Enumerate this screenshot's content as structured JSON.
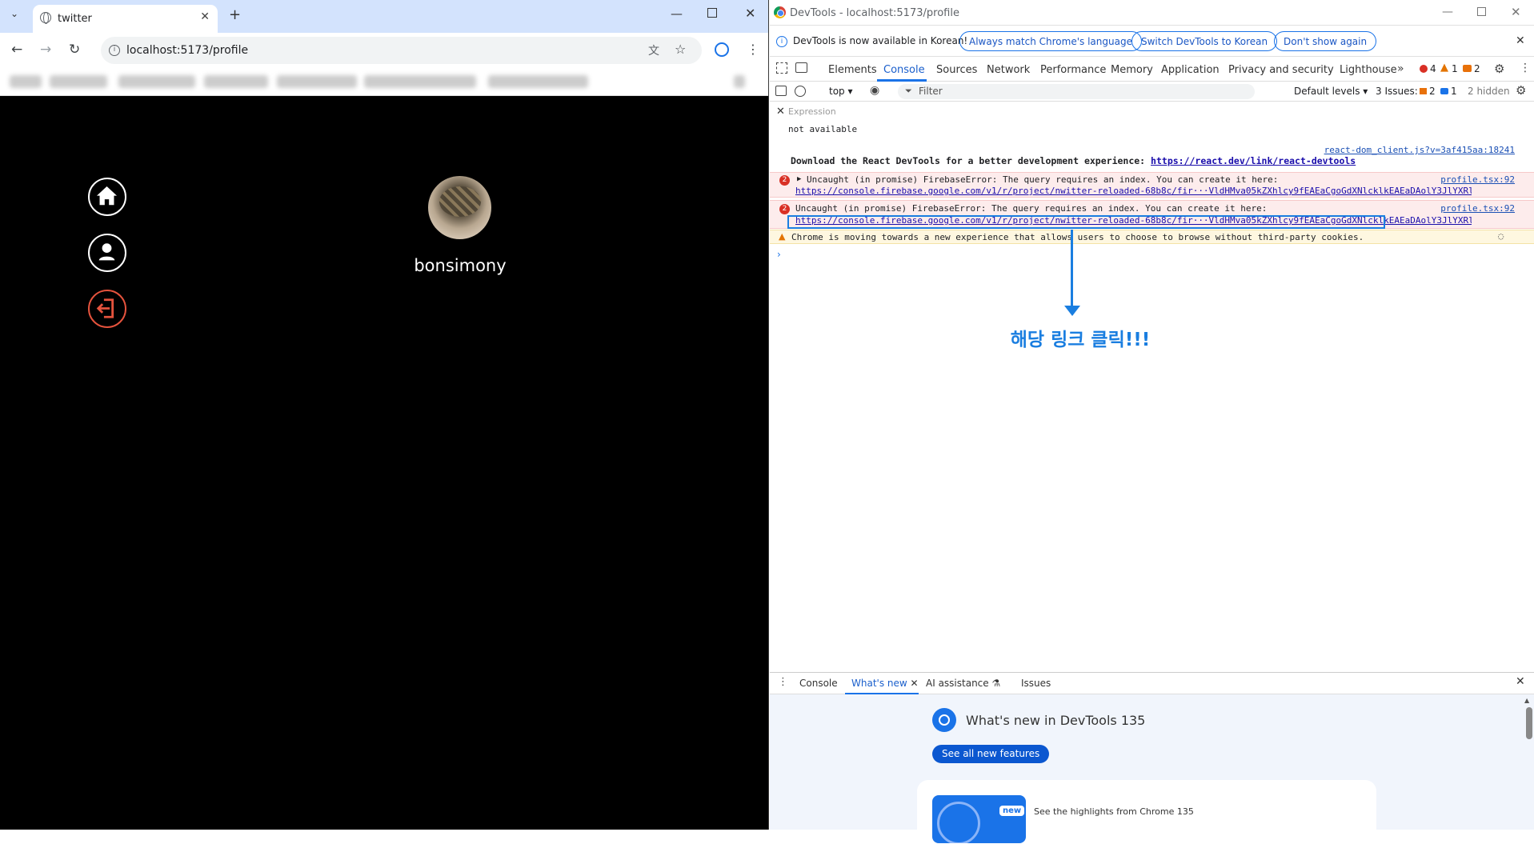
{
  "browser": {
    "tab_title": "twitter",
    "url": "localhost:5173/profile",
    "profile_name": "bonsimony"
  },
  "devtools": {
    "window_title": "DevTools - localhost:5173/profile",
    "infobar": {
      "message": "DevTools is now available in Korean!",
      "btn_match": "Always match Chrome's language",
      "btn_switch": "Switch DevTools to Korean",
      "btn_dismiss": "Don't show again"
    },
    "tabs": [
      "Elements",
      "Console",
      "Sources",
      "Network",
      "Performance",
      "Memory",
      "Application",
      "Privacy and security",
      "Lighthouse"
    ],
    "counts": {
      "errors": "4",
      "warnings": "1",
      "issues": "2"
    },
    "console_toolbar": {
      "context": "top",
      "filter_placeholder": "Filter",
      "levels": "Default levels",
      "issues_label": "3 Issues:",
      "issues_err": "2",
      "issues_info": "1",
      "hidden": "2 hidden"
    },
    "expression": {
      "label": "Expression",
      "value": "not available"
    },
    "messages": {
      "react_src": "react-dom_client.js?v=3af415aa:18241",
      "react_text": "Download the React DevTools for a better development experience: ",
      "react_link": "https://react.dev/link/react-devtools",
      "err1_text": "Uncaught (in promise) FirebaseError: The query requires an index. You can create it here:",
      "err1_link": "https://console.firebase.google.com/v1/r/project/nwitter-reloaded-68b8c/fir···VldHMva05kZXhlcy9fEAEaCgoGdXNlcklkEAEaDAolY3JlYXRlQXQQAhoMCghfX25hbWVf",
      "err1_src": "profile.tsx:92",
      "err1_count": "2",
      "err2_text": "Uncaught (in promise) FirebaseError: The query requires an index. You can create it here:",
      "err2_link": "https://console.firebase.google.com/v1/r/project/nwitter-reloaded-68b8c/fir···VldHMva05kZXhlcy9fEAEaCgoGdXNlcklkEAEaDAolY3JlYXRlQXQQAhoMCghfX25hbWVf",
      "err2_src": "profile.tsx:92",
      "err2_count": "2",
      "warn_text": "Chrome is moving towards a new experience that allows users to choose to browse without third-party cookies."
    },
    "annotation": "해당 링크 클릭!!!",
    "drawer": {
      "tabs": [
        "Console",
        "What's new",
        "AI assistance",
        "Issues"
      ],
      "heading": "What's new in DevTools 135",
      "button": "See all new features",
      "card_badge": "new",
      "card_text": "See the highlights from Chrome 135"
    }
  }
}
